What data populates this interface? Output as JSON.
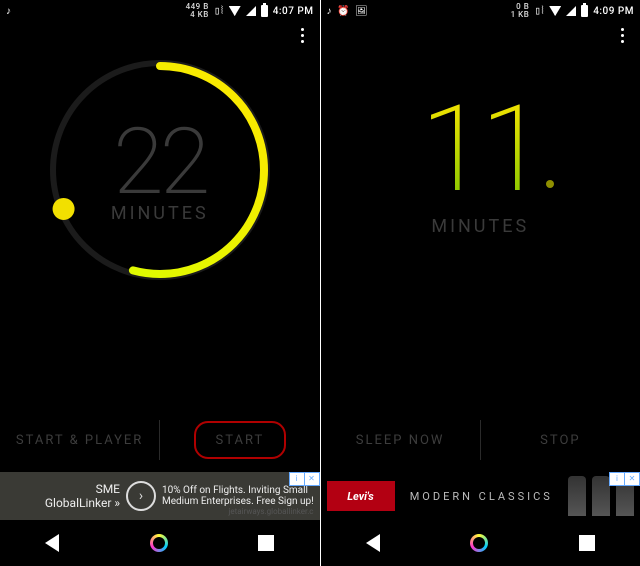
{
  "left": {
    "status": {
      "net_top": "449 B",
      "net_bot": "4 KB",
      "time": "4:07 PM"
    },
    "timer": {
      "value": "22",
      "unit": "MINUTES",
      "progress_deg": 195
    },
    "buttons": {
      "a": "START & PLAYER",
      "b": "START"
    },
    "ad": {
      "brand_top": "SME",
      "brand_bot": "GlobalLinker »",
      "copy": "10% Off on Flights. Inviting Small Medium Enterprises. Free Sign up!",
      "attribution": "jetairways.globallinker.c"
    }
  },
  "right": {
    "status": {
      "net_top": "0 B",
      "net_bot": "1 KB",
      "time": "4:09 PM"
    },
    "timer": {
      "value": "11",
      "unit": "MINUTES"
    },
    "buttons": {
      "a": "SLEEP NOW",
      "b": "STOP"
    },
    "ad": {
      "logo": "Levi's",
      "copy": "MODERN CLASSICS"
    }
  },
  "adchoices": {
    "info": "i",
    "close": "✕"
  }
}
